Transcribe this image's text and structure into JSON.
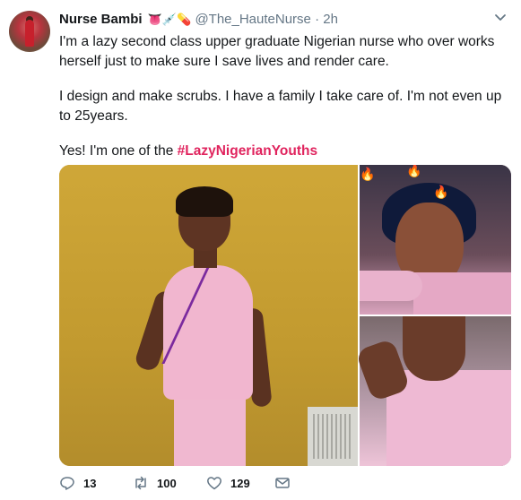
{
  "tweet": {
    "display_name": "Nurse Bambi",
    "name_emojis": "👅💉💊",
    "handle": "@The_HauteNurse",
    "separator": "·",
    "time": "2h",
    "paragraphs": [
      "I'm a lazy second class upper graduate Nigerian nurse who over works herself just to make sure I save lives and render care.",
      "I design and make scrubs. I have a family I take care of. I'm not even up to 25years."
    ],
    "last_line_prefix": "Yes! I'm one of the ",
    "hashtag": "#LazyNigerianYouths",
    "hashtag_color": "#e0245e",
    "flame_emoji": "🔥"
  },
  "actions": {
    "replies": "13",
    "retweets": "100",
    "likes": "129"
  },
  "icons": {
    "reply": "reply-icon",
    "retweet": "retweet-icon",
    "like": "heart-icon",
    "dm": "envelope-icon",
    "more": "chevron-down-icon"
  }
}
